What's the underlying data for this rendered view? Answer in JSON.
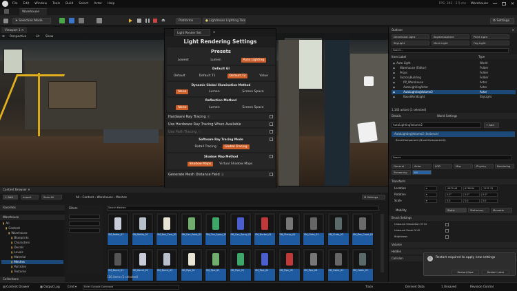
{
  "menu": [
    "File",
    "Edit",
    "Window",
    "Tools",
    "Build",
    "Select",
    "Actor",
    "Help"
  ],
  "titlebar_right": {
    "fps": "FPS: 393 · 2.5 ms",
    "project": "Warehouse"
  },
  "project_tab": "Warehouse",
  "toolbar": {
    "mode": "Selection Mode",
    "platforms": "Platforms",
    "lighting": "Lightmass Lighting Tool",
    "settings": "Settings"
  },
  "viewport": {
    "tab": "Viewport 1",
    "perspective": "Perspective",
    "lit": "Lit",
    "show": "Show"
  },
  "panel": {
    "tab_label": "Light Render Set",
    "title": "Light Rendering Settings",
    "presets_title": "Presets",
    "presets": [
      {
        "label": "Lowest",
        "selected": false
      },
      {
        "label": "Lumen",
        "selected": false
      },
      {
        "label": "Auto Lighting",
        "selected": true
      }
    ],
    "default_gi_title": "Default GI",
    "default_gi": [
      {
        "label": "Default",
        "selected": false
      },
      {
        "label": "Default T1",
        "selected": false
      },
      {
        "label": "Default T2",
        "selected": true
      },
      {
        "label": "Value",
        "selected": false
      }
    ],
    "dynamic_gi_title": "Dynamic Global Illumination Method",
    "dynamic_gi": [
      {
        "label": "None",
        "selected": true
      },
      {
        "label": "Lumen",
        "selected": false
      },
      {
        "label": "Screen Space",
        "selected": false
      }
    ],
    "reflection_title": "Reflection Method",
    "reflection": [
      {
        "label": "None",
        "selected": true
      },
      {
        "label": "Lumen",
        "selected": false
      },
      {
        "label": "Screen Space",
        "selected": false
      }
    ],
    "hw_ray": "Hardware Ray Tracing",
    "hw_ray_avail": "Use Hardware Ray Tracing When Available",
    "path_tracing": "Use Path Tracing",
    "sw_ray_title": "Software Ray Tracing Mode",
    "sw_ray": [
      {
        "label": "Detail Tracing",
        "selected": false
      },
      {
        "label": "Global Tracing",
        "selected": true
      }
    ],
    "shadow_title": "Shadow Map Method",
    "shadow": [
      {
        "label": "Shadow Maps",
        "selected": true
      },
      {
        "label": "Virtual Shadow Maps",
        "selected": false
      }
    ],
    "mesh_df": "Generate Mesh Distance Field"
  },
  "outliner": {
    "tab": "Outliner",
    "buttons": [
      "Directional Light",
      "SkyAtmosphere",
      "Point Light",
      "SkyLight",
      "Mesh Light",
      "Fog Light"
    ],
    "search": "Search...",
    "col_label": "Item Label",
    "col_type": "Type",
    "items": [
      {
        "label": "Auto Light",
        "type": "World",
        "indent": 0,
        "sel": false
      },
      {
        "label": "Warehouse (Editor)",
        "type": "Folder",
        "indent": 1,
        "sel": false
      },
      {
        "label": "Props",
        "type": "Folder",
        "indent": 1,
        "sel": false
      },
      {
        "label": "FactoryBuilding",
        "type": "Folder",
        "indent": 1,
        "sel": false
      },
      {
        "label": "PP_Warehouse",
        "type": "Actor",
        "indent": 2,
        "sel": false
      },
      {
        "label": "AutoLightingActor",
        "type": "Actor",
        "indent": 2,
        "sel": false
      },
      {
        "label": "AutoLightingVolume2",
        "type": "Actor",
        "indent": 2,
        "sel": true
      },
      {
        "label": "BaseWorldLight",
        "type": "SkyLight",
        "indent": 2,
        "sel": false
      }
    ],
    "footer": "1,143 actors (1 selected)"
  },
  "details": {
    "tabs": [
      "Details",
      "World Settings"
    ],
    "object": "AutoLightingVolume2",
    "add": "+ Add",
    "component": "AutoLightingVolume2 (Instance)",
    "sub": "BrushComponent (BrushComponent0)",
    "search": "Search",
    "cat_tabs": [
      "General",
      "Actor",
      "LOD",
      "Misc",
      "Physics",
      "Rendering",
      "Streaming",
      "All"
    ],
    "transform_title": "Transform",
    "transform_rows": [
      {
        "label": "Location",
        "x": "-9679.44",
        "y": "6138.84",
        "z": "-1131.70"
      },
      {
        "label": "Rotation",
        "x": "0.0°",
        "y": "0.0°",
        "z": "0.0°"
      },
      {
        "label": "Scale",
        "x": "5.0",
        "y": "5.0",
        "z": "5.0"
      }
    ],
    "mobility_label": "Mobility",
    "mobility": [
      "Static",
      "Stationary",
      "Movable"
    ],
    "brush_settings": "Brush Settings",
    "volume_title": "Volume",
    "hidden_title": "Hidden",
    "collision_title": "Collision",
    "auto_rows": [
      "Unbound Simulation Of GI",
      "Unbound Scale Of GI",
      "Brightness"
    ],
    "toast": {
      "message": "Restart required to apply new settings",
      "btn1": "Restart Now",
      "btn2": "Restart Later"
    }
  },
  "content_browser": {
    "tab": "Content Browser",
    "add": "+ Add",
    "import": "Import",
    "save_all": "Save All",
    "path": [
      "All",
      "Content",
      "Warehouse",
      "Meshes"
    ],
    "settings": "Settings",
    "favorites": "Favorites",
    "root": "Warehouse",
    "folders": [
      "All",
      "Content",
      "Warehouse",
      "Blueprints",
      "Characters",
      "Decals",
      "Levels",
      "Material",
      "Meshes",
      "Particles",
      "Textures"
    ],
    "filters": "Filters",
    "search": "Search Meshes",
    "items": [
      "SM_Bottle_01",
      "SM_Bottle_02",
      "SM_Box_Card_01",
      "SM_Can_Paint_01",
      "SM_Can_Spray_01",
      "SM_Can_Spray_02",
      "SM_Bucket_01",
      "SM_Clamp_01",
      "SM_Crate_01",
      "SM_Crate_02",
      "SM_Box_Crate_01",
      "SM_Barrel_01",
      "SM_Barrel_02",
      "SM_Barrel_03",
      "SM_Pipe_01",
      "SM_Pipe_02",
      "SM_Pipe_03",
      "SM_Pipe_04",
      "SM_Pipe_05",
      "SM_Pipe_06",
      "SM_Cable_01",
      "SM_Cable_02"
    ],
    "footer": "116 items (1 selected)",
    "collections": "Collections"
  },
  "statusbar": {
    "drawer": "Content Drawer",
    "output": "Output Log",
    "cmd": "Cmd",
    "console": "Enter Console Command",
    "trace": "Trace",
    "derived": "Derived Data",
    "unsaved": "1 Unsaved",
    "revision": "Revision Control"
  },
  "colors": {
    "accent": "#d0602a",
    "select": "#1b4a78"
  }
}
